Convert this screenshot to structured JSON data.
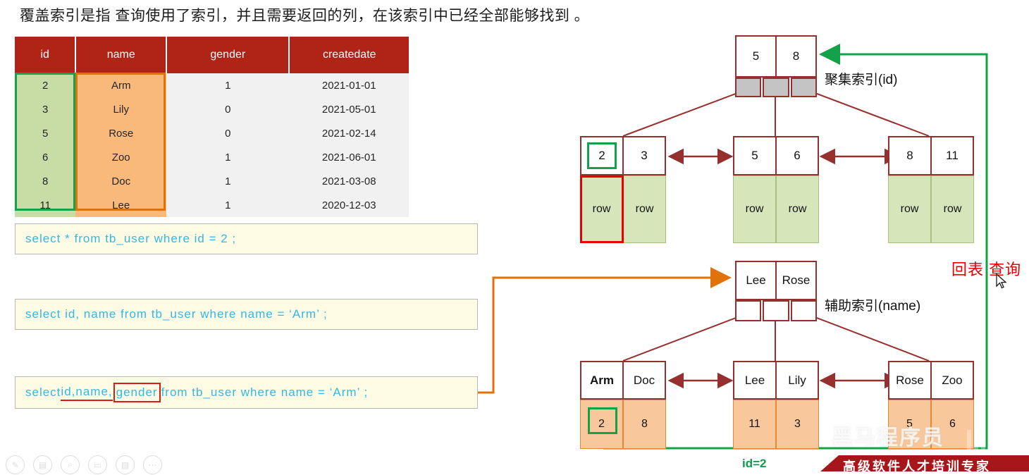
{
  "slide": {
    "title": "覆盖索引是指 查询使用了索引，并且需要返回的列，在该索引中已经全部能够找到 。"
  },
  "table": {
    "headers": [
      "id",
      "name",
      "gender",
      "createdate"
    ],
    "rows": [
      {
        "id": "2",
        "name": "Arm",
        "gender": "1",
        "createdate": "2021-01-01"
      },
      {
        "id": "3",
        "name": "Lily",
        "gender": "0",
        "createdate": "2021-05-01"
      },
      {
        "id": "5",
        "name": "Rose",
        "gender": "0",
        "createdate": "2021-02-14"
      },
      {
        "id": "6",
        "name": "Zoo",
        "gender": "1",
        "createdate": "2021-06-01"
      },
      {
        "id": "8",
        "name": "Doc",
        "gender": "1",
        "createdate": "2021-03-08"
      },
      {
        "id": "11",
        "name": "Lee",
        "gender": "1",
        "createdate": "2020-12-03"
      }
    ],
    "header_color": "#b02418",
    "id_highlight_color": "#13a14a",
    "name_highlight_color": "#e1720a"
  },
  "sql": {
    "q1": "select  *  from  tb_user  where  id  =  2 ;",
    "q2": "select  id, name  from  tb_user  where  name = ‘Arm’ ;",
    "q3": {
      "before": "select  ",
      "underlined": "id,name,",
      "boxed": "gender",
      "after": "  from  tb_user  where  name = ‘Arm’ ;"
    },
    "text_color": "#32b8e8",
    "box_bg": "#fdfbe4"
  },
  "clustered_index": {
    "label": "聚集索引(id)",
    "root": {
      "keys": [
        "5",
        "8"
      ],
      "pointers": 3,
      "pointer_fill": "gray"
    },
    "leaves": [
      {
        "keys": [
          "2",
          "3"
        ],
        "data": [
          "row",
          "row"
        ],
        "highlight_key": "2",
        "highlight_data": "row"
      },
      {
        "keys": [
          "5",
          "6"
        ],
        "data": [
          "row",
          "row"
        ]
      },
      {
        "keys": [
          "8",
          "11"
        ],
        "data": [
          "row",
          "row"
        ]
      }
    ],
    "data_cell_color": "#d7e5bb"
  },
  "secondary_index": {
    "label": "辅助索引(name)",
    "root": {
      "keys": [
        "Lee",
        "Rose"
      ],
      "pointers": 3,
      "pointer_fill": "white"
    },
    "leaves": [
      {
        "keys": [
          "Arm",
          "Doc"
        ],
        "data": [
          "2",
          "8"
        ],
        "highlight_data": "2"
      },
      {
        "keys": [
          "Lee",
          "Lily"
        ],
        "data": [
          "11",
          "3"
        ]
      },
      {
        "keys": [
          "Rose",
          "Zoo"
        ],
        "data": [
          "5",
          "6"
        ]
      }
    ],
    "data_cell_color": "#f9c79c"
  },
  "annotations": {
    "lookup_label": "回表 查询",
    "lookup_color": "#e60000",
    "id_equals_label": "id=2",
    "id_equals_color": "#119b4a",
    "orange_path_color": "#e1720a",
    "green_path_color": "#13a14a",
    "tree_line_color": "#96302e"
  },
  "toolbar": {
    "icons": [
      "pen-icon",
      "slides-icon",
      "zoom-icon",
      "blank-screen-icon",
      "video-off-icon",
      "more-options-icon"
    ],
    "glyphs": [
      "✎",
      "▤",
      "⌕",
      "▭",
      "▧",
      "⋯"
    ]
  },
  "branding": {
    "watermark": "黑马程序员",
    "banner": "高级软件人才培训专家",
    "banner_color": "#a7161a"
  }
}
